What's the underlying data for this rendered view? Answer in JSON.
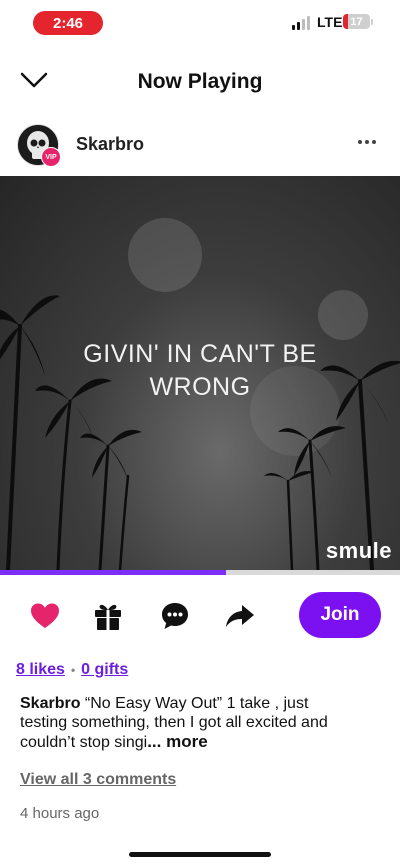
{
  "status_bar": {
    "time": "2:46",
    "network": "LTE",
    "battery": "17",
    "battery_level": 0.17
  },
  "header": {
    "title": "Now Playing",
    "collapse_icon": "chevron-down-icon"
  },
  "post": {
    "username": "Skarbro",
    "badge": "VIP",
    "lyric_text": "GIVIN' IN CAN'T BE WRONG",
    "watermark": "smule",
    "progress": 0.565
  },
  "actions": {
    "like_icon": "heart-icon",
    "gift_icon": "gift-icon",
    "comment_icon": "comment-icon",
    "share_icon": "share-icon",
    "join_label": "Join",
    "accent": "#7b10f0",
    "like_color": "#e6246b"
  },
  "meta": {
    "likes": "8 likes",
    "separator": "•",
    "gifts": "0 gifts"
  },
  "caption": {
    "user": "Skarbro",
    "text": " “No Easy Way Out”  1 take , just testing something, then I got all excited and couldn’t stop singi",
    "more": "... more"
  },
  "comments_link": "View all 3 comments",
  "timestamp": "4 hours ago"
}
